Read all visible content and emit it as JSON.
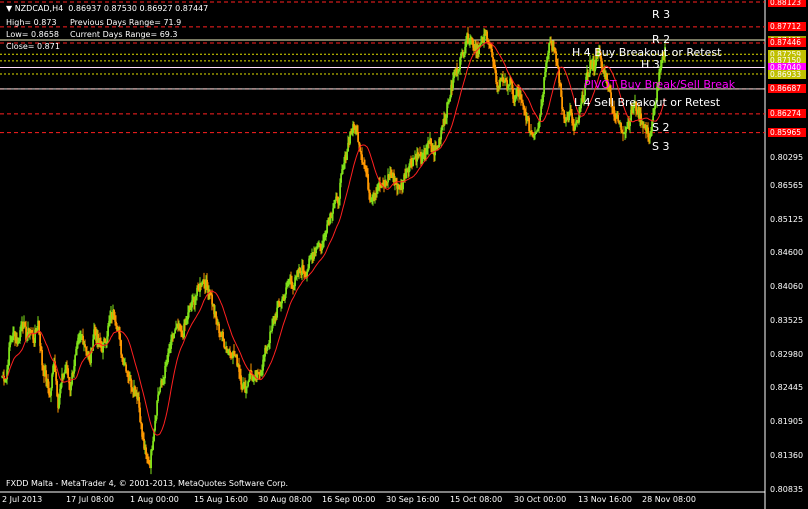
{
  "header": {
    "symbol": "▼ NZDCAD,H4  0.86937 0.87530 0.86927 0.87447",
    "high": "High= 0.873",
    "low": "Low= 0.8658",
    "close": "Close= 0.871",
    "prev_range": "Previous Days Range= 71.9",
    "curr_range": "Current Days Range= 69.3"
  },
  "footer": "FXDD Malta - MetaTrader 4, © 2001-2013, MetaQuotes Software Corp.",
  "levels": {
    "r3": "R 3",
    "r2": "R 2",
    "h4": "H 4 Buy Breakout or Retest",
    "h3": "H 3",
    "piv": "PIVOT Buy Break/Sell Break",
    "l4": "L 4 Sell Breakout or Retest",
    "s2": "S 2",
    "s3": "S 3"
  },
  "price_tags": [
    {
      "value": "0.88123",
      "color": "#ff0000"
    },
    {
      "value": "0.87712",
      "color": "#ff0000"
    },
    {
      "value": "0.87495",
      "color": "#a0a000"
    },
    {
      "value": "0.87446",
      "color": "#ff0000"
    },
    {
      "value": "0.87259",
      "color": "#c0c000"
    },
    {
      "value": "0.87150",
      "color": "#c0c000"
    },
    {
      "value": "0.87040",
      "color": "#ff00ff"
    },
    {
      "value": "0.86933",
      "color": "#c0c000"
    },
    {
      "value": "0.86687",
      "color": "#ff0000"
    },
    {
      "value": "0.86274",
      "color": "#ff0000"
    },
    {
      "value": "0.85965",
      "color": "#ff0000"
    }
  ],
  "colors": {
    "bull": "#7fe01a",
    "bear": "#ff9900",
    "ma": "#ff2020",
    "pivot": "#ff00ff",
    "level": "#ff0000"
  },
  "chart_data": {
    "type": "line",
    "series_note": "",
    "y_ticks": [
      "0.86565",
      "0.85125",
      "0.84600",
      "0.84060",
      "0.83525",
      "0.82980",
      "0.82445",
      "0.81905",
      "0.81360",
      "0.80835",
      "0.80295"
    ],
    "x_ticks": [
      "2 Jul 2013",
      "17 Jul 08:00",
      "1 Aug 00:00",
      "15 Aug 16:00",
      "30 Aug 08:00",
      "16 Sep 00:00",
      "30 Sep 16:00",
      "15 Oct 08:00",
      "30 Oct 00:00",
      "13 Nov 16:00",
      "28 Nov 08:00"
    ],
    "ylim": [
      0.80045,
      0.88123
    ],
    "price_path": [
      [
        0,
        0.8195
      ],
      [
        4,
        0.819
      ],
      [
        8,
        0.825
      ],
      [
        12,
        0.8265
      ],
      [
        16,
        0.8248
      ],
      [
        20,
        0.829
      ],
      [
        24,
        0.826
      ],
      [
        28,
        0.827
      ],
      [
        32,
        0.8255
      ],
      [
        36,
        0.8285
      ],
      [
        40,
        0.8215
      ],
      [
        44,
        0.819
      ],
      [
        48,
        0.816
      ],
      [
        52,
        0.8225
      ],
      [
        56,
        0.815
      ],
      [
        60,
        0.819
      ],
      [
        64,
        0.821
      ],
      [
        68,
        0.8175
      ],
      [
        72,
        0.8215
      ],
      [
        76,
        0.825
      ],
      [
        80,
        0.826
      ],
      [
        84,
        0.824
      ],
      [
        88,
        0.822
      ],
      [
        92,
        0.827
      ],
      [
        96,
        0.825
      ],
      [
        100,
        0.824
      ],
      [
        104,
        0.8258
      ],
      [
        108,
        0.829
      ],
      [
        112,
        0.83
      ],
      [
        116,
        0.827
      ],
      [
        120,
        0.8225
      ],
      [
        124,
        0.821
      ],
      [
        128,
        0.8185
      ],
      [
        132,
        0.8175
      ],
      [
        136,
        0.816
      ],
      [
        140,
        0.8095
      ],
      [
        144,
        0.806
      ],
      [
        148,
        0.805
      ],
      [
        152,
        0.811
      ],
      [
        156,
        0.8165
      ],
      [
        160,
        0.8185
      ],
      [
        164,
        0.821
      ],
      [
        168,
        0.824
      ],
      [
        172,
        0.8265
      ],
      [
        176,
        0.8275
      ],
      [
        180,
        0.826
      ],
      [
        184,
        0.8285
      ],
      [
        188,
        0.8305
      ],
      [
        192,
        0.832
      ],
      [
        196,
        0.8335
      ],
      [
        200,
        0.8355
      ],
      [
        204,
        0.8345
      ],
      [
        208,
        0.8335
      ],
      [
        212,
        0.83
      ],
      [
        216,
        0.8275
      ],
      [
        220,
        0.826
      ],
      [
        224,
        0.824
      ],
      [
        228,
        0.8235
      ],
      [
        232,
        0.823
      ],
      [
        236,
        0.8215
      ],
      [
        240,
        0.818
      ],
      [
        244,
        0.8175
      ],
      [
        248,
        0.82
      ],
      [
        252,
        0.8185
      ],
      [
        256,
        0.8195
      ],
      [
        260,
        0.821
      ],
      [
        264,
        0.824
      ],
      [
        268,
        0.826
      ],
      [
        272,
        0.8285
      ],
      [
        276,
        0.831
      ],
      [
        280,
        0.832
      ],
      [
        284,
        0.8335
      ],
      [
        288,
        0.8355
      ],
      [
        292,
        0.8345
      ],
      [
        296,
        0.8365
      ],
      [
        300,
        0.837
      ],
      [
        304,
        0.8365
      ],
      [
        308,
        0.8385
      ],
      [
        312,
        0.84
      ],
      [
        316,
        0.8415
      ],
      [
        320,
        0.8405
      ],
      [
        324,
        0.844
      ],
      [
        328,
        0.846
      ],
      [
        332,
        0.848
      ],
      [
        336,
        0.8485
      ],
      [
        340,
        0.853
      ],
      [
        344,
        0.856
      ],
      [
        348,
        0.8595
      ],
      [
        352,
        0.8605
      ],
      [
        356,
        0.859
      ],
      [
        360,
        0.8555
      ],
      [
        364,
        0.853
      ],
      [
        368,
        0.849
      ],
      [
        372,
        0.8495
      ],
      [
        376,
        0.851
      ],
      [
        380,
        0.8505
      ],
      [
        384,
        0.8515
      ],
      [
        388,
        0.853
      ],
      [
        392,
        0.852
      ],
      [
        396,
        0.8505
      ],
      [
        400,
        0.851
      ],
      [
        404,
        0.8535
      ],
      [
        408,
        0.8545
      ],
      [
        412,
        0.8555
      ],
      [
        416,
        0.856
      ],
      [
        420,
        0.855
      ],
      [
        424,
        0.857
      ],
      [
        428,
        0.858
      ],
      [
        432,
        0.8565
      ],
      [
        436,
        0.8575
      ],
      [
        440,
        0.861
      ],
      [
        444,
        0.863
      ],
      [
        448,
        0.866
      ],
      [
        452,
        0.869
      ],
      [
        456,
        0.8705
      ],
      [
        460,
        0.8725
      ],
      [
        464,
        0.875
      ],
      [
        468,
        0.8755
      ],
      [
        472,
        0.874
      ],
      [
        476,
        0.8735
      ],
      [
        480,
        0.8745
      ],
      [
        484,
        0.876
      ],
      [
        488,
        0.874
      ],
      [
        492,
        0.87
      ],
      [
        496,
        0.867
      ],
      [
        500,
        0.869
      ],
      [
        504,
        0.8675
      ],
      [
        508,
        0.868
      ],
      [
        512,
        0.865
      ],
      [
        516,
        0.8665
      ],
      [
        520,
        0.864
      ],
      [
        524,
        0.8625
      ],
      [
        528,
        0.86
      ],
      [
        532,
        0.8595
      ],
      [
        536,
        0.861
      ],
      [
        540,
        0.865
      ],
      [
        544,
        0.872
      ],
      [
        548,
        0.875
      ],
      [
        552,
        0.873
      ],
      [
        556,
        0.87
      ],
      [
        560,
        0.864
      ],
      [
        564,
        0.8615
      ],
      [
        568,
        0.863
      ],
      [
        572,
        0.86
      ],
      [
        576,
        0.8615
      ],
      [
        580,
        0.865
      ],
      [
        584,
        0.868
      ],
      [
        588,
        0.871
      ],
      [
        592,
        0.8705
      ],
      [
        596,
        0.8735
      ],
      [
        600,
        0.87
      ],
      [
        604,
        0.869
      ],
      [
        608,
        0.866
      ],
      [
        612,
        0.863
      ],
      [
        616,
        0.8615
      ],
      [
        620,
        0.86
      ],
      [
        624,
        0.8605
      ],
      [
        628,
        0.862
      ],
      [
        632,
        0.8645
      ],
      [
        636,
        0.863
      ],
      [
        640,
        0.8615
      ],
      [
        644,
        0.86
      ],
      [
        648,
        0.859
      ],
      [
        652,
        0.863
      ],
      [
        656,
        0.868
      ],
      [
        660,
        0.8714
      ],
      [
        664,
        0.874
      ]
    ]
  }
}
